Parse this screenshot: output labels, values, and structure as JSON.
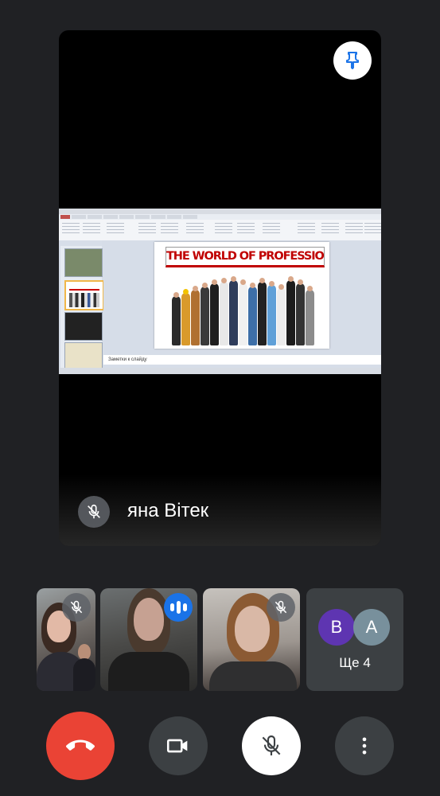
{
  "main_tile": {
    "participant_name": "яна Вітек",
    "mic_state": "muted",
    "shared_screen": {
      "slide_title": "THE WORLD OF PROFESSIONS",
      "notes_placeholder": "Заметки к слайду"
    }
  },
  "participants": [
    {
      "mic_state": "muted"
    },
    {
      "mic_state": "speaking"
    },
    {
      "mic_state": "muted"
    }
  ],
  "overflow": {
    "avatars": [
      "B",
      "A"
    ],
    "avatar_colors": [
      "#5e35b1",
      "#78909c"
    ],
    "label": "Ще 4"
  },
  "controls": {
    "end_call_color": "#ea4335",
    "icons": [
      "end-call-icon",
      "camera-icon",
      "mic-off-icon",
      "more-vert-icon"
    ]
  }
}
